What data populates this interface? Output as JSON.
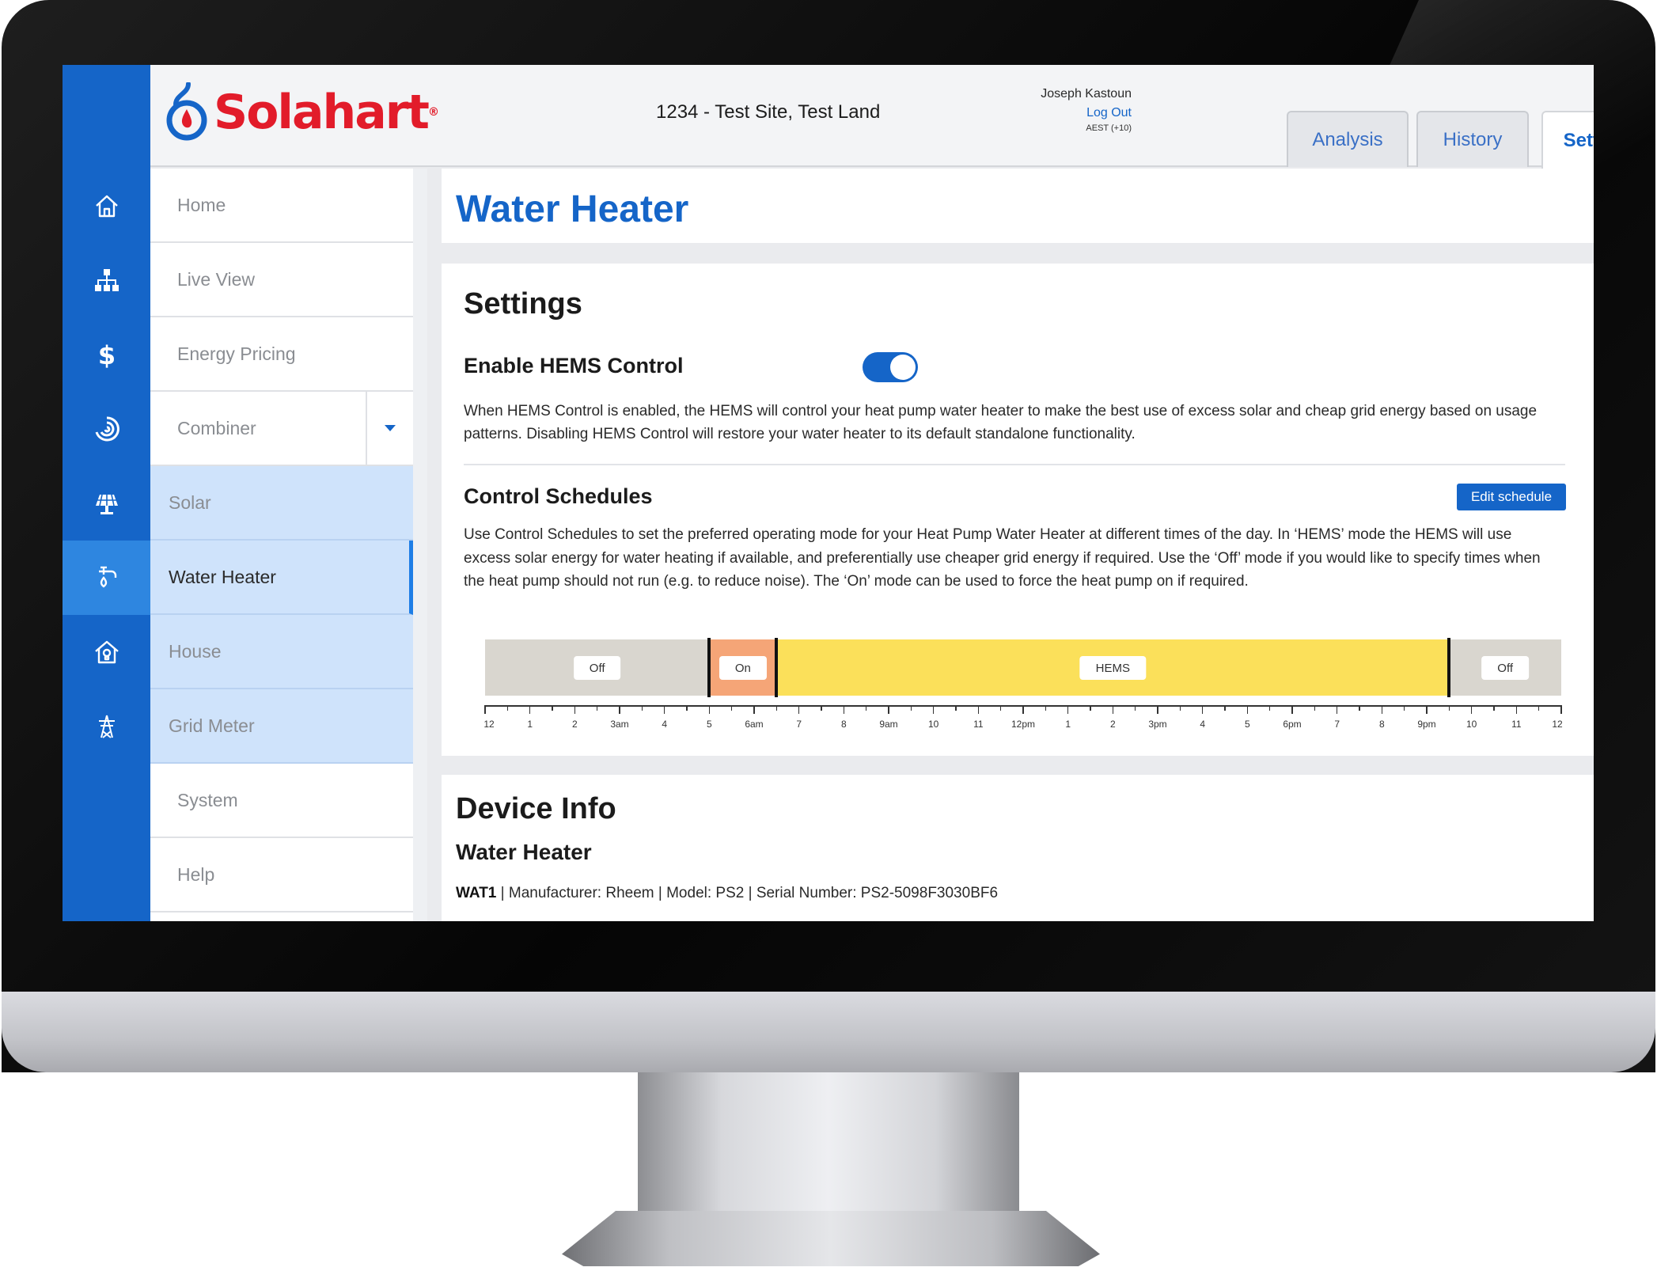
{
  "header": {
    "brand": "Solahart",
    "site": "1234 - Test Site, Test Land",
    "user": "Joseph Kastoun",
    "logout": "Log Out",
    "timezone": "AEST (+10)",
    "tabs": [
      "Analysis",
      "History",
      "Settings"
    ],
    "active_tab": "Settings"
  },
  "rail": {
    "icons": [
      "home-icon",
      "network-icon",
      "dollar-icon",
      "swirl-icon",
      "solar-panel-icon",
      "water-heater-icon",
      "house-bulb-icon",
      "pylon-icon"
    ],
    "active_index": 5
  },
  "nav": {
    "items": [
      {
        "label": "Home",
        "type": "top"
      },
      {
        "label": "Live View",
        "type": "top"
      },
      {
        "label": "Energy Pricing",
        "type": "top"
      },
      {
        "label": "Combiner",
        "type": "top",
        "expandable": true
      },
      {
        "label": "Solar",
        "type": "sub"
      },
      {
        "label": "Water Heater",
        "type": "sub",
        "active": true
      },
      {
        "label": "House",
        "type": "sub"
      },
      {
        "label": "Grid Meter",
        "type": "sub"
      },
      {
        "label": "System",
        "type": "top"
      },
      {
        "label": "Help",
        "type": "top"
      }
    ]
  },
  "page": {
    "title": "Water Heater"
  },
  "settings": {
    "heading": "Settings",
    "hems_label": "Enable HEMS Control",
    "hems_enabled": true,
    "hems_description": "When HEMS Control is enabled, the HEMS will control your heat pump water heater to make the best use of excess solar and cheap grid energy based on usage patterns. Disabling HEMS Control will restore your water heater to its default standalone functionality.",
    "schedules_heading": "Control Schedules",
    "edit_button": "Edit schedule",
    "schedules_description": "Use Control Schedules to set the preferred operating mode for your Heat Pump Water Heater at different times of the day. In ‘HEMS’ mode the HEMS will use excess solar energy for water heating if available, and preferentially use cheaper grid energy if required. Use the ‘Off’ mode if you would like to specify times when the heat pump should not run (e.g. to reduce noise). The ‘On’ mode can be used to force the heat pump on if required."
  },
  "schedule": {
    "segments": [
      {
        "mode": "Off",
        "start": 0,
        "end": 5,
        "color": "#d9d6cf"
      },
      {
        "mode": "On",
        "start": 5,
        "end": 6.5,
        "color": "#f5a577"
      },
      {
        "mode": "HEMS",
        "start": 6.5,
        "end": 21.5,
        "color": "#fbe05a"
      },
      {
        "mode": "Off",
        "start": 21.5,
        "end": 24,
        "color": "#d9d6cf"
      }
    ],
    "tick_labels": [
      "12",
      "1",
      "2",
      "3am",
      "4",
      "5",
      "6am",
      "7",
      "8",
      "9am",
      "10",
      "11",
      "12pm",
      "1",
      "2",
      "3pm",
      "4",
      "5",
      "6pm",
      "7",
      "8",
      "9pm",
      "10",
      "11",
      "12"
    ]
  },
  "device": {
    "heading": "Device Info",
    "subheading": "Water Heater",
    "id": "WAT1",
    "details": " | Manufacturer: Rheem | Model: PS2 | Serial Number: PS2-5098F3030BF6"
  },
  "colors": {
    "brand_blue": "#1565c8",
    "brand_red": "#e21c2a",
    "nav_sub_bg": "#cfe3fb"
  }
}
